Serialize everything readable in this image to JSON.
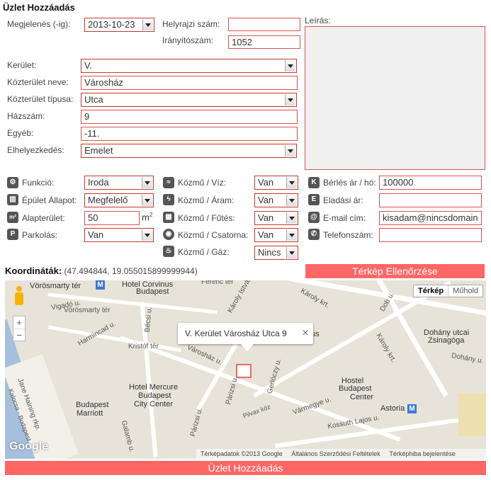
{
  "title": "Üzlet Hozzáadás",
  "labels": {
    "megjelenes": "Megjelenés (-ig):",
    "helyrajzi": "Helyrajzi szám:",
    "iranyitoszam": "Irányítószám:",
    "leiras": "Leírás:",
    "kerulet": "Kerület:",
    "kozterulet_neve": "Közterület neve:",
    "kozterulet_tipusa": "Közterület típusa:",
    "hazszam": "Házszám:",
    "egyeb": "Egyéb:",
    "elhelyezkedes": "Elhelyezkedés:",
    "funkcio": "Funkció:",
    "epulet_allapot": "Épület Állapot:",
    "alapterulet": "Alapterület:",
    "parkolas": "Parkolás:",
    "viz": "Közmű / Víz:",
    "aram": "Közmű / Áram:",
    "futes": "Közmű / Fűtés:",
    "csatorna": "Közmű / Csatorna:",
    "gaz": "Közmű / Gáz:",
    "berles": "Bérlés ár / hó:",
    "eladasi": "Eladási ár:",
    "email": "E-mail cím:",
    "telefon": "Telefonszám:",
    "m2_unit": "m",
    "m2_sup": "2"
  },
  "values": {
    "megjelenes": "2013-10-23",
    "helyrajzi": "",
    "iranyitoszam": "1052",
    "leiras": "",
    "kerulet": "V.",
    "kozterulet_neve": "Városház",
    "kozterulet_tipusa": "Utca",
    "hazszam": "9",
    "egyeb": "-11.",
    "elhelyezkedes": "Emelet",
    "funkcio": "Iroda",
    "epulet_allapot": "Megfelelő",
    "alapterulet": "50",
    "parkolas": "Van",
    "viz": "Van",
    "aram": "Van",
    "futes": "Van",
    "csatorna": "Van",
    "gaz": "Nincs",
    "berles": "100000",
    "eladasi": "",
    "email": "kisadam@nincsdomain",
    "telefon": ""
  },
  "icons": {
    "funkcio": "gear-icon",
    "epulet": "building-icon",
    "alapterulet": "m2-icon",
    "parkolas": "parking-icon",
    "viz": "water-icon",
    "aram": "lightning-icon",
    "futes": "heating-icon",
    "csatorna": "sewer-icon",
    "gaz": "flame-icon",
    "berles": "k-icon",
    "eladasi": "e-icon",
    "email": "at-icon",
    "telefon": "phone-icon"
  },
  "icon_glyphs": {
    "m2": "m²",
    "p": "P",
    "k": "K",
    "e": "E",
    "at": "@"
  },
  "koordinatak": {
    "label": "Koordináták:",
    "value": "(47.494844, 19.055015899999944)"
  },
  "buttons": {
    "terkep_ellenorzese": "Térkép Ellenőrzése",
    "uzlet_hozzaadas": "Üzlet Hozzáadás"
  },
  "map": {
    "tab_map": "Térkép",
    "tab_satellite": "Műhold",
    "zoom_in": "+",
    "zoom_out": "−",
    "popup": "V. Kerület Városház Utca 9",
    "popup_close": "✕",
    "logo": "Google",
    "footer_data": "Térképadatok ©2013 Google",
    "footer_terms": "Általános Szerződési Feltételek",
    "footer_report": "Térképhiba bejelentése",
    "places": {
      "vorosmarty_ter_top": "Vörösmarty tér",
      "metro_m": "M",
      "hotel_corvinus": "Hotel Corvinus",
      "hotel_corvinus_city": "Budapest",
      "ferenc_ter": "Ferenc tér",
      "karoly_krt_top": "Károly krt.",
      "dob_u": "Dob u.",
      "karoly_krt_right": "Károly krt.",
      "vigado_u": "Vigadó u.",
      "vorosmarty_ter": "Vörösmarty tér",
      "becsi_u": "Bécsi u.",
      "harmincad_u": "Harmincad u.",
      "kristof_ter": "Kristóf tér",
      "varoshaz_u": "Városház u.",
      "gerloczy_u": "Gerlóczy u.",
      "novus": "us",
      "dohany": "Dohány utcai",
      "zsinagoga": "Zsinagóga",
      "dohany_u": "Dohány u.",
      "jane_haining": "Jane Haining rkp.",
      "hotel_mercure": "Hotel Mercure",
      "hotel_mercure_2": "Budapest",
      "hotel_mercure_3": "City Center",
      "marriott_1": "Budapest",
      "marriott_2": "Marriott",
      "parizsi_u": "Párizsi u.",
      "pilvax": "Pilvax köz",
      "vármegye": "Vármegye u.",
      "hostel_1": "Hostel",
      "hostel_2": "Budapest",
      "hostel_3": "Center",
      "astoria": "Astoria",
      "kossuth": "Kossuth Lajos u.",
      "galamb": "Galamb u.",
      "kalocsa": "Kalocsa - Budapest",
      "karoly_istvan": "Károly István u."
    }
  }
}
